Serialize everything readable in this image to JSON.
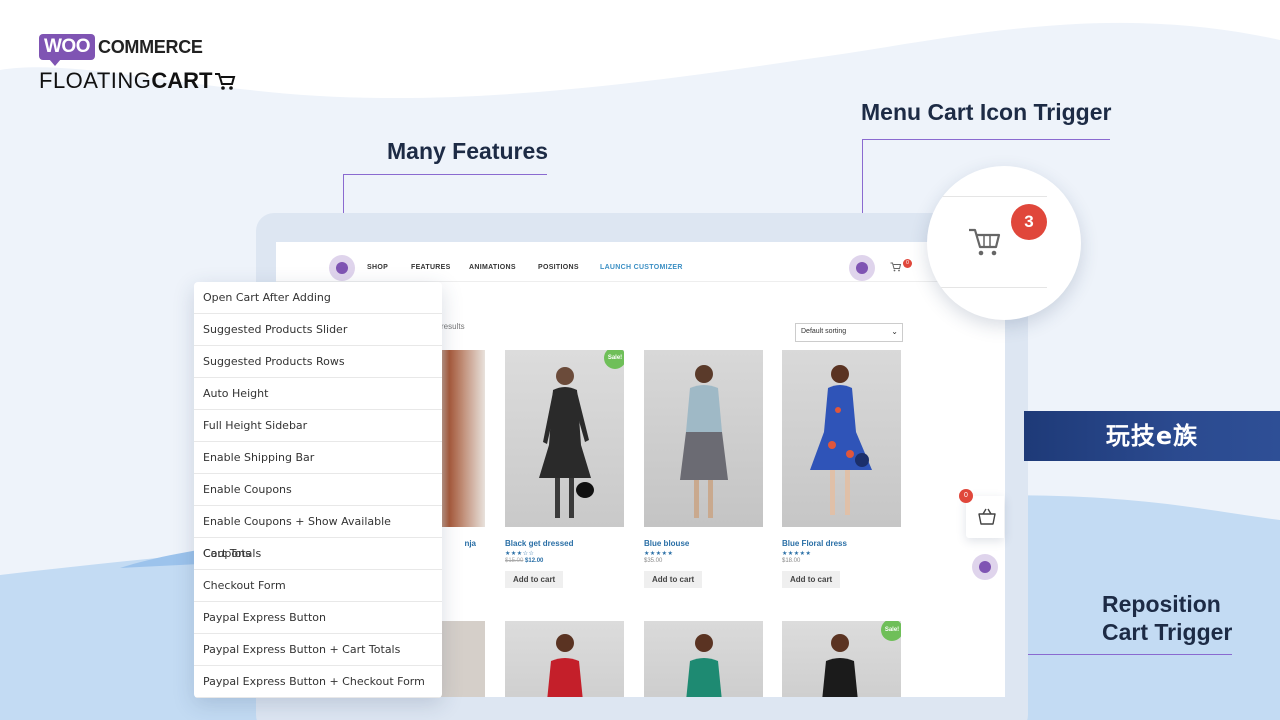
{
  "logo": {
    "woo": "WOO",
    "commerce": "COMMERCE",
    "floating": "FLOATING",
    "cart": "CART"
  },
  "callouts": {
    "many_features": "Many Features",
    "menu_cart_icon_trigger": "Menu Cart Icon Trigger",
    "reposition_line1": "Reposition",
    "reposition_line2": "Cart Trigger"
  },
  "nav": {
    "items": [
      "SHOP",
      "FEATURES",
      "ANIMATIONS",
      "POSITIONS",
      "LAUNCH CUSTOMIZER"
    ],
    "cart_count": "0"
  },
  "shop": {
    "results_text": "results",
    "sort_label": "Default sorting",
    "partial_product_name": "nja",
    "products": [
      {
        "name": "Black get dressed",
        "stars": "★★★☆☆",
        "old_price": "$15.00",
        "price": "$12.00",
        "sale": "Sale!",
        "button": "Add to cart"
      },
      {
        "name": "Blue blouse",
        "stars": "★★★★★",
        "price": "$35.00",
        "button": "Add to cart"
      },
      {
        "name": "Blue Floral dress",
        "stars": "★★★★★",
        "price": "$18.00",
        "button": "Add to cart"
      }
    ],
    "second_row_sale": "Sale!"
  },
  "features": [
    "Open Cart After Adding",
    "Suggested Products Slider",
    "Suggested Products Rows",
    "Auto Height",
    "Full Height Sidebar",
    "Enable Shipping Bar",
    "Enable Coupons",
    "Enable Coupons + Show Available Coupons",
    "Cart Totals",
    "Checkout Form",
    "Paypal Express Button",
    "Paypal Express Button + Cart Totals",
    "Paypal Express Button + Checkout Form"
  ],
  "zoom": {
    "cart_count": "3"
  },
  "side_cart": {
    "count": "0"
  },
  "watermark": "玩技e族",
  "colors": {
    "accent": "#7f54b3",
    "badge": "#e0473b",
    "link": "#2a6fa6",
    "sale": "#6fbf59"
  }
}
